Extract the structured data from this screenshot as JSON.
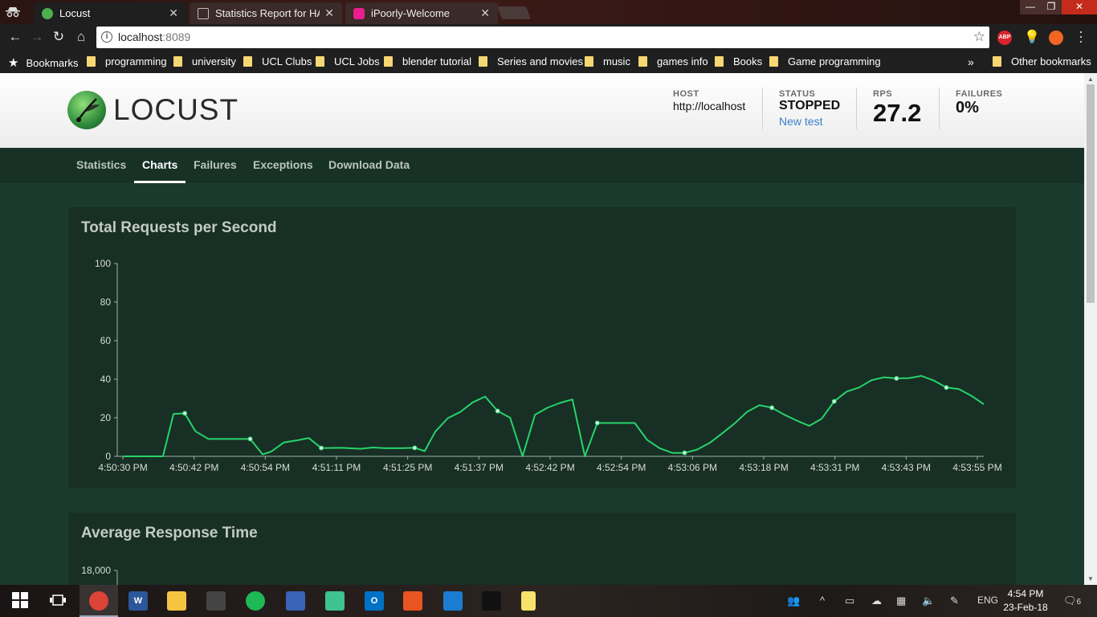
{
  "browser": {
    "tabs": [
      {
        "title": "Locust",
        "active": true,
        "favicon_color": "#4caf50"
      },
      {
        "title": "Statistics Report for HAProxy",
        "active": false,
        "favicon_color": "#9e9e9e"
      },
      {
        "title": "iPoorly-Welcome",
        "active": false,
        "favicon_color": "#e91e8c"
      }
    ],
    "url_host": "localhost",
    "url_port": ":8089",
    "bookmarks_label": "Bookmarks",
    "bookmarks": [
      "programming",
      "university",
      "UCL Clubs",
      "UCL Jobs",
      "blender tutorial",
      "Series and movies",
      "music",
      "games info",
      "Books",
      "Game programming"
    ],
    "overflow_label": "»",
    "other_bookmarks": "Other bookmarks",
    "extensions": [
      {
        "name": "adblock-plus-icon",
        "label": "ABP",
        "color": "#d9232d"
      },
      {
        "name": "lightbulb-icon",
        "label": "",
        "color": "#f0b400"
      },
      {
        "name": "fire-icon",
        "label": "",
        "color": "#f26522"
      }
    ]
  },
  "header": {
    "logo_text": "LOCUST",
    "host_label": "HOST",
    "host_value": "http://localhost",
    "status_label": "STATUS",
    "status_value": "STOPPED",
    "new_test": "New test",
    "rps_label": "RPS",
    "rps_value": "27.2",
    "failures_label": "FAILURES",
    "failures_value": "0%"
  },
  "nav": {
    "items": [
      "Statistics",
      "Charts",
      "Failures",
      "Exceptions",
      "Download Data"
    ],
    "active": "Charts"
  },
  "panels": {
    "rps_title": "Total Requests per Second",
    "response_title": "Average Response Time",
    "response_first_tick": "18,000"
  },
  "chart_data": [
    {
      "type": "line",
      "title": "Total Requests per Second",
      "xlabel": "",
      "ylabel": "",
      "ylim": [
        0,
        100
      ],
      "y_ticks": [
        0,
        20,
        40,
        60,
        80,
        100
      ],
      "x_tick_labels": [
        "4:50:30 PM",
        "4:50:42 PM",
        "4:50:54 PM",
        "4:51:11 PM",
        "4:51:25 PM",
        "4:51:37 PM",
        "4:52:42 PM",
        "4:52:54 PM",
        "4:53:06 PM",
        "4:53:18 PM",
        "4:53:31 PM",
        "4:53:43 PM",
        "4:53:55 PM"
      ],
      "grid": false,
      "legend": "none",
      "line_color": "#27d36b",
      "series": [
        {
          "points": [
            [
              0,
              0
            ],
            [
              4,
              0
            ],
            [
              6.3,
              0
            ],
            [
              8.0,
              22
            ],
            [
              9.8,
              22.3
            ],
            [
              11.5,
              13
            ],
            [
              13.6,
              9
            ],
            [
              16.6,
              9
            ],
            [
              20.3,
              9
            ],
            [
              22.3,
              1
            ],
            [
              23.7,
              2.5
            ],
            [
              25.7,
              7.2
            ],
            [
              27.7,
              8.2
            ],
            [
              29.7,
              9.5
            ],
            [
              31.7,
              4.3
            ],
            [
              35.0,
              4.4
            ],
            [
              38.0,
              3.9
            ],
            [
              40.0,
              4.6
            ],
            [
              42.0,
              4.2
            ],
            [
              44.5,
              4.2
            ],
            [
              46.7,
              4.4
            ],
            [
              48.3,
              2.7
            ],
            [
              50.0,
              12.8
            ],
            [
              52.0,
              19.8
            ],
            [
              54.0,
              23
            ],
            [
              56.0,
              28
            ],
            [
              58.0,
              31
            ],
            [
              60.0,
              23.5
            ],
            [
              62.0,
              20
            ],
            [
              64.0,
              0
            ],
            [
              66.0,
              21.6
            ],
            [
              68.0,
              25.2
            ],
            [
              70.0,
              27.7
            ],
            [
              72.0,
              29.5
            ],
            [
              74.0,
              0
            ],
            [
              76.0,
              17.3
            ],
            [
              78.0,
              17.3
            ],
            [
              80.3,
              17.3
            ],
            [
              82.0,
              17.3
            ],
            [
              84.0,
              8.5
            ],
            [
              86.0,
              4.2
            ],
            [
              88.0,
              1.8
            ],
            [
              90.0,
              1.8
            ],
            [
              92.0,
              3.5
            ],
            [
              94.0,
              6.9
            ],
            [
              96.0,
              11.8
            ],
            [
              98.0,
              17
            ],
            [
              100.0,
              23
            ],
            [
              102.0,
              26.5
            ],
            [
              104.0,
              25.2
            ],
            [
              106.0,
              21.6
            ],
            [
              108.0,
              18.5
            ],
            [
              110.0,
              15.8
            ],
            [
              112.0,
              19.5
            ],
            [
              114.0,
              28.5
            ],
            [
              116.0,
              33.6
            ],
            [
              118.0,
              35.7
            ],
            [
              120.0,
              39.5
            ],
            [
              122.0,
              41
            ],
            [
              124.0,
              40.4
            ],
            [
              126.0,
              40.6
            ],
            [
              128.0,
              41.7
            ],
            [
              130.0,
              39.3
            ],
            [
              132.0,
              35.7
            ],
            [
              134.0,
              34.9
            ],
            [
              136.0,
              31.4
            ],
            [
              138.0,
              27
            ]
          ],
          "marker_indices": [
            4,
            8,
            14,
            20,
            27,
            35,
            42,
            49,
            54,
            59,
            63
          ]
        }
      ]
    }
  ],
  "taskbar": {
    "apps": [
      {
        "name": "chrome-icon",
        "color": "#db4437",
        "label": ""
      },
      {
        "name": "word-icon",
        "color": "#2b579a",
        "label": "W"
      },
      {
        "name": "file-explorer-icon",
        "color": "#f5c542",
        "label": ""
      },
      {
        "name": "app-icon",
        "color": "#444",
        "label": ""
      },
      {
        "name": "spotify-icon",
        "color": "#1db954",
        "label": ""
      },
      {
        "name": "app-blue-icon",
        "color": "#3a63b8",
        "label": ""
      },
      {
        "name": "atom-icon",
        "color": "#3ec28f",
        "label": ""
      },
      {
        "name": "outlook-icon",
        "color": "#0072c6",
        "label": "O"
      },
      {
        "name": "ubuntu-icon",
        "color": "#e95420",
        "label": ""
      },
      {
        "name": "vscode-icon",
        "color": "#1b7dd1",
        "label": ""
      },
      {
        "name": "terminal-icon",
        "color": "#111",
        "label": ""
      },
      {
        "name": "sticky-notes-icon",
        "color": "#f7e26b",
        "label": ""
      }
    ],
    "language": "ENG",
    "time": "4:54 PM",
    "date": "23-Feb-18",
    "notification_count": "6"
  }
}
